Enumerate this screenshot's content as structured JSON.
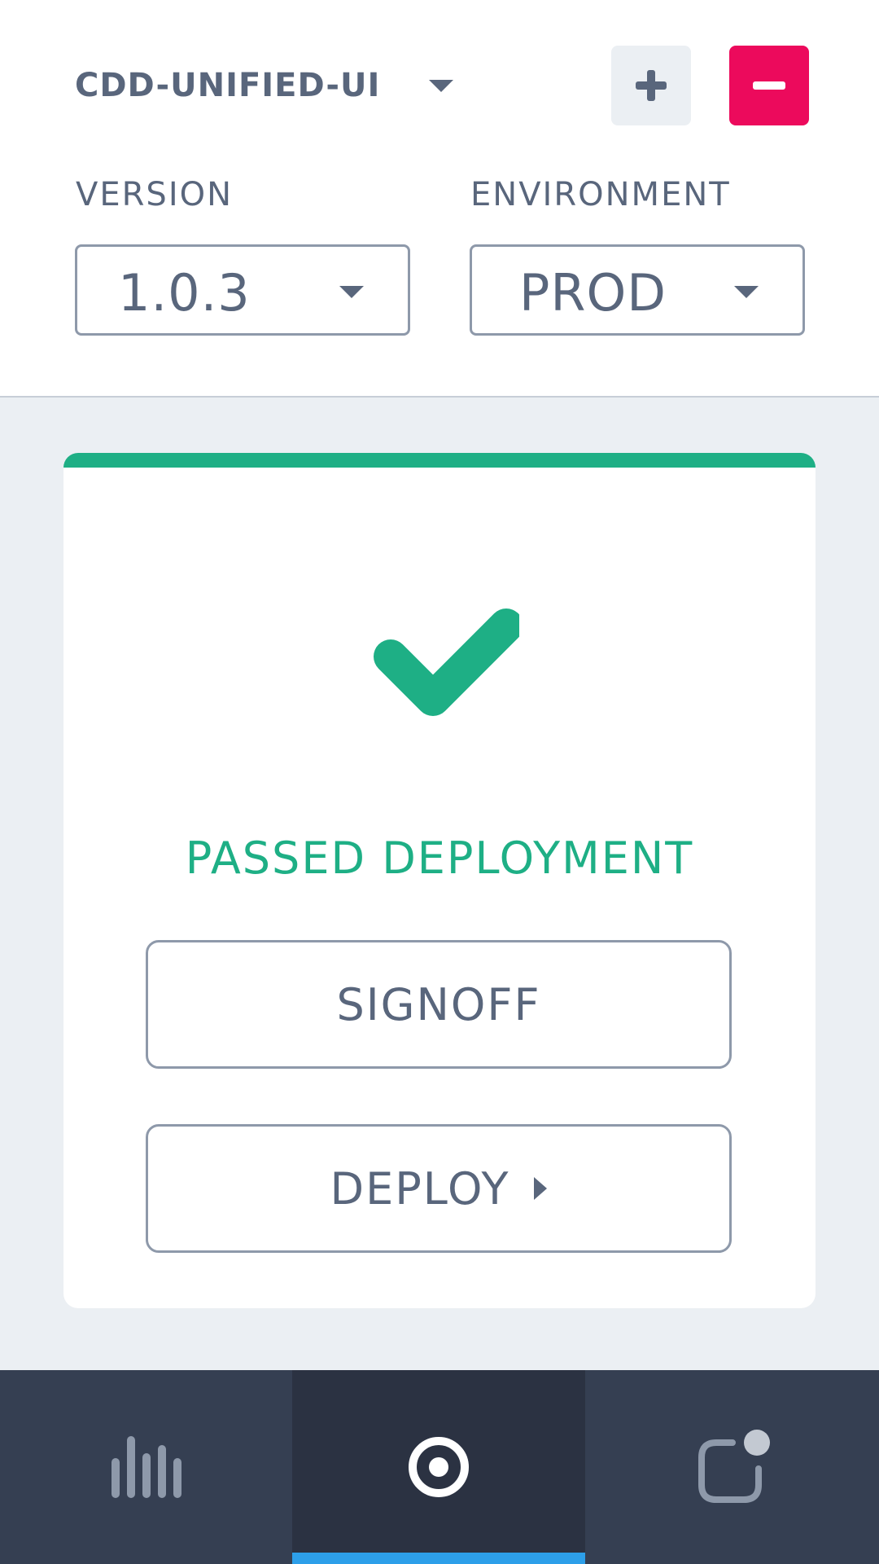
{
  "header": {
    "app_name": "CDD-UNIFIED-UI",
    "add_icon": "plus-icon",
    "remove_icon": "minus-icon",
    "version": {
      "label": "VERSION",
      "value": "1.0.3"
    },
    "environment": {
      "label": "ENVIRONMENT",
      "value": "PROD"
    }
  },
  "card": {
    "status_icon": "checkmark-icon",
    "status_text": "PASSED DEPLOYMENT",
    "signoff_label": "SIGNOFF",
    "deploy_label": "DEPLOY"
  },
  "nav": {
    "tabs": [
      {
        "icon": "bar-chart-icon",
        "active": false
      },
      {
        "icon": "target-icon",
        "active": true
      },
      {
        "icon": "notification-icon",
        "active": false
      }
    ]
  },
  "colors": {
    "accent_success": "#1eaf85",
    "danger": "#ec0a5c",
    "nav_bg": "#353f52",
    "nav_active_bg": "#2b3242",
    "active_indicator": "#2d9fe9",
    "text": "#59667c"
  }
}
